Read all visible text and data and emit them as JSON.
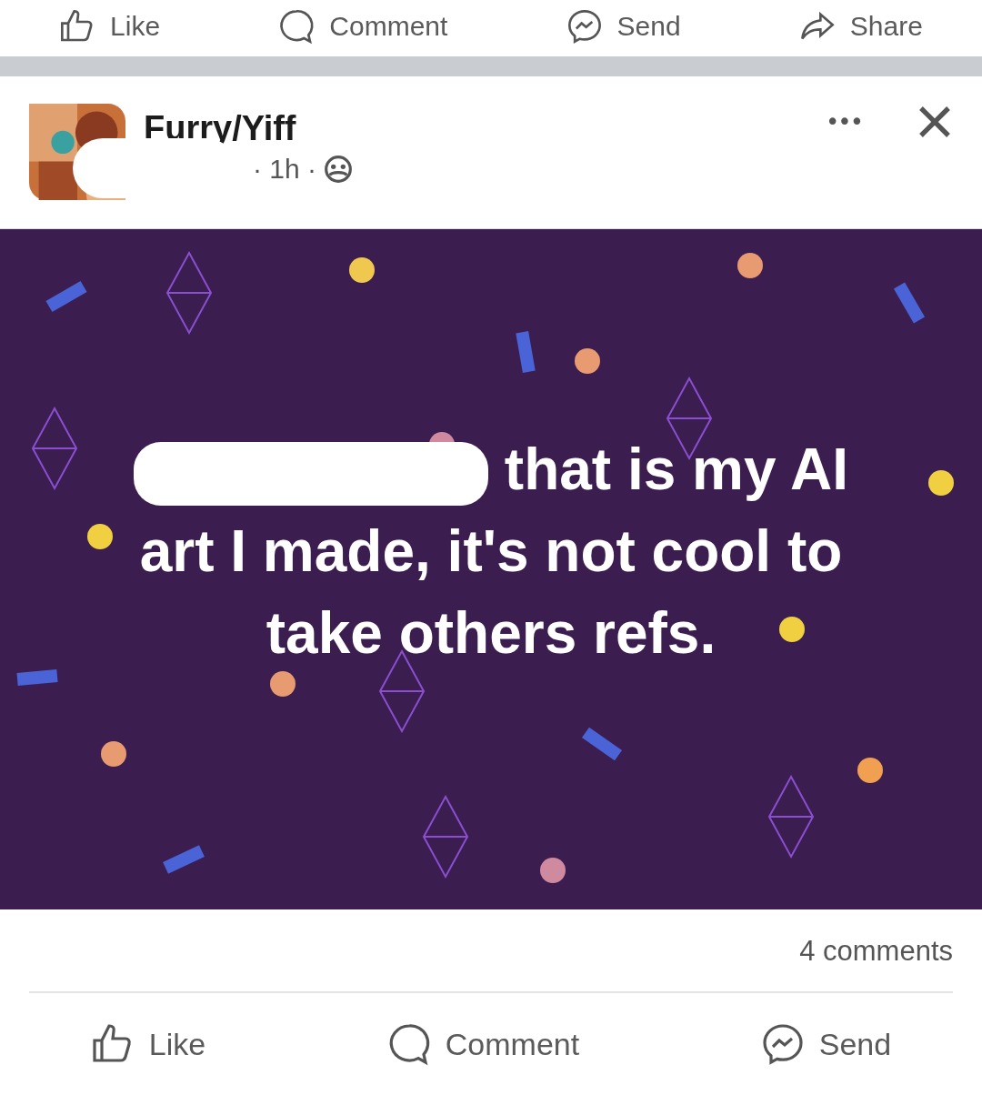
{
  "top_actions": [
    {
      "kind": "like",
      "label": "Like"
    },
    {
      "kind": "comment",
      "label": "Comment"
    },
    {
      "kind": "send",
      "label": "Send"
    },
    {
      "kind": "share",
      "label": "Share"
    }
  ],
  "post": {
    "group": "Furry/Yiff",
    "meta": "· 1h ·",
    "more": "•••",
    "text": "that is my AI art I made, it's not cool to take others refs.",
    "comments_count": "4 comments"
  },
  "actions": [
    {
      "kind": "like",
      "label": "Like"
    },
    {
      "kind": "comment",
      "label": "Comment"
    },
    {
      "kind": "send",
      "label": "Send"
    }
  ]
}
